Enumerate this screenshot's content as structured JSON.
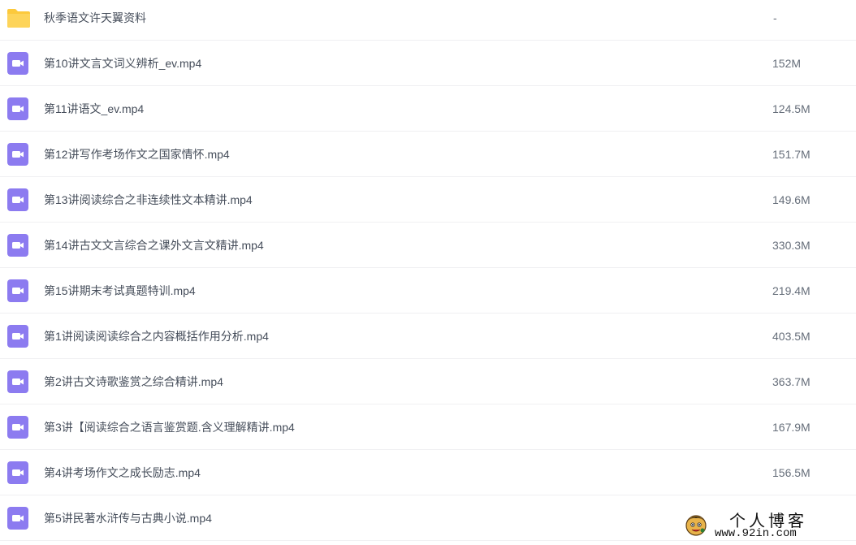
{
  "files": [
    {
      "type": "folder",
      "icon": "folder-icon",
      "name": "秋季语文许天翼资料",
      "size": "-"
    },
    {
      "type": "video",
      "icon": "video-file-icon",
      "name": "第10讲文言文词义辨析_ev.mp4",
      "size": "152M"
    },
    {
      "type": "video",
      "icon": "video-file-icon",
      "name": "第11讲语文_ev.mp4",
      "size": "124.5M"
    },
    {
      "type": "video",
      "icon": "video-file-icon",
      "name": "第12讲写作考场作文之国家情怀.mp4",
      "size": "151.7M"
    },
    {
      "type": "video",
      "icon": "video-file-icon",
      "name": "第13讲阅读综合之非连续性文本精讲.mp4",
      "size": "149.6M"
    },
    {
      "type": "video",
      "icon": "video-file-icon",
      "name": "第14讲古文文言综合之课外文言文精讲.mp4",
      "size": "330.3M"
    },
    {
      "type": "video",
      "icon": "video-file-icon",
      "name": "第15讲期末考试真题特训.mp4",
      "size": "219.4M"
    },
    {
      "type": "video",
      "icon": "video-file-icon",
      "name": "第1讲阅读阅读综合之内容概括作用分析.mp4",
      "size": "403.5M"
    },
    {
      "type": "video",
      "icon": "video-file-icon",
      "name": "第2讲古文诗歌鉴赏之综合精讲.mp4",
      "size": "363.7M"
    },
    {
      "type": "video",
      "icon": "video-file-icon",
      "name": "第3讲【阅读综合之语言鉴赏题.含义理解精讲.mp4",
      "size": "167.9M"
    },
    {
      "type": "video",
      "icon": "video-file-icon",
      "name": "第4讲考场作文之成长励志.mp4",
      "size": "156.5M"
    },
    {
      "type": "video",
      "icon": "video-file-icon",
      "name": "第5讲民著水浒传与古典小说.mp4",
      "size": ""
    }
  ],
  "watermark": {
    "title": "个人博客",
    "url": "www.92in.com",
    "icon": "cartoon-face-logo"
  },
  "colors": {
    "folder": "#fcc93c",
    "video": "#8c7bf0",
    "text": "#454d5a",
    "divider": "#f0f0f2"
  }
}
